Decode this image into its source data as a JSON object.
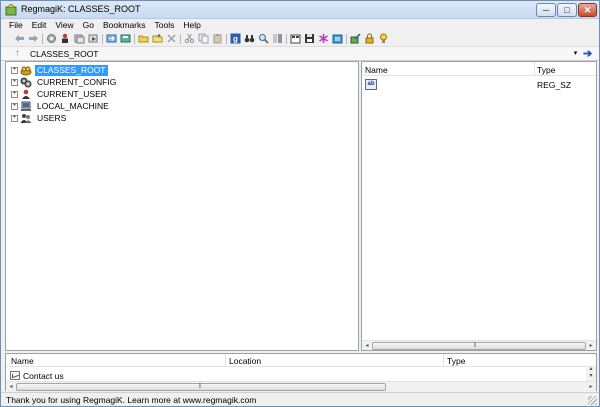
{
  "window": {
    "title": "RegmagiK: CLASSES_ROOT",
    "controls": {
      "minimize": "─",
      "maximize": "□",
      "close": "✕"
    }
  },
  "menu": [
    "File",
    "Edit",
    "View",
    "Go",
    "Bookmarks",
    "Tools",
    "Help"
  ],
  "toolbar": {
    "icons": [
      "back-arrow-icon",
      "forward-arrow-icon",
      "refresh-gear-icon",
      "user-key-icon",
      "copy-key-icon",
      "import-icon",
      "export-icon",
      "new-folder-icon",
      "new-value-icon",
      "delete-x-icon",
      "cut-icon",
      "copy-icon",
      "paste-icon",
      "google-search-icon",
      "binoculars-find-icon",
      "search-zoom-icon",
      "compare-icon",
      "open-file-icon",
      "save-disk-icon",
      "asterisk-icon",
      "registry-cube-icon",
      "edit-pencil-icon",
      "lock-icon",
      "help-lightbulb-icon"
    ]
  },
  "address": {
    "path": "CLASSES_ROOT",
    "up_glyph": "↑",
    "dropdown_glyph": "▾",
    "go_glyph": "➔"
  },
  "tree": {
    "expander_glyph": "+",
    "items": [
      {
        "label": "CLASSES_ROOT",
        "icon": "classes-root-icon",
        "selected": true
      },
      {
        "label": "CURRENT_CONFIG",
        "icon": "current-config-icon",
        "selected": false
      },
      {
        "label": "CURRENT_USER",
        "icon": "current-user-icon",
        "selected": false
      },
      {
        "label": "LOCAL_MACHINE",
        "icon": "local-machine-icon",
        "selected": false
      },
      {
        "label": "USERS",
        "icon": "users-icon",
        "selected": false
      }
    ]
  },
  "values_list": {
    "columns": {
      "name": "Name",
      "type": "Type"
    },
    "rows": [
      {
        "icon_text": "ab",
        "name": "",
        "type": "REG_SZ"
      }
    ],
    "scroll_left": "◂",
    "scroll_right": "▸",
    "grip": "|||"
  },
  "bookmarks_list": {
    "columns": {
      "name": "Name",
      "location": "Location",
      "type": "Type"
    },
    "rows": [
      {
        "name": "Contact us",
        "location": "",
        "type": ""
      }
    ],
    "scroll_left": "◂",
    "scroll_right": "▸",
    "scroll_up": "▴",
    "scroll_down": "▾",
    "grip": "|||"
  },
  "status": {
    "text": "Thank you for using RegmagiK. Learn more at www.regmagik.com"
  }
}
